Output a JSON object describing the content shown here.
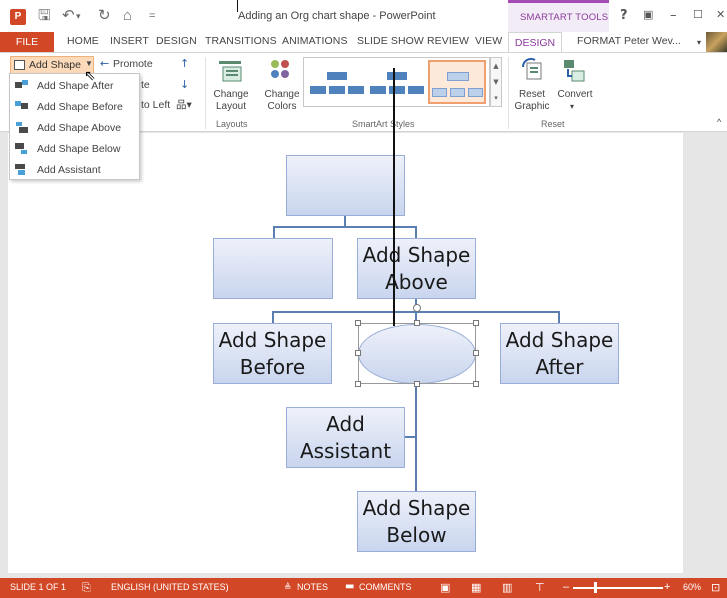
{
  "window": {
    "title": "Adding an Org chart shape - PowerPoint",
    "app_icon": "P",
    "context_group": "SMARTART TOOLS",
    "help": "?",
    "restore": "▣",
    "minimize": "–",
    "maximize": "☐",
    "close": "✕"
  },
  "quick_access": {
    "save": "🖫",
    "undo": "↶",
    "undo_caret": "▾",
    "redo": "↻",
    "slideshow": "⌂",
    "customize": "="
  },
  "tabs": [
    "FILE",
    "HOME",
    "INSERT",
    "DESIGN",
    "TRANSITIONS",
    "ANIMATIONS",
    "SLIDE SHOW",
    "REVIEW",
    "VIEW",
    "DESIGN",
    "FORMAT"
  ],
  "user": {
    "name": "Peter Wev...",
    "caret": "▾"
  },
  "ribbon": {
    "add_shape": "Add Shape",
    "promote": "Promote",
    "demote_partial": "te",
    "right_to_left_partial": "to Left",
    "change_layout": "Change\nLayout",
    "change_colors": "Change\nColors",
    "layouts_group": "Layouts",
    "smartart_styles_group": "SmartArt Styles",
    "reset_graphic": "Reset\nGraphic",
    "convert": "Convert",
    "reset_group": "Reset",
    "collapse": "^"
  },
  "dropdown": [
    {
      "label": "Add Shape After",
      "icon": "add-shape-after-icon"
    },
    {
      "label": "Add Shape Before",
      "icon": "add-shape-before-icon"
    },
    {
      "label": "Add Shape Above",
      "icon": "add-shape-above-icon"
    },
    {
      "label": "Add Shape Below",
      "icon": "add-shape-below-icon"
    },
    {
      "label": "Add Assistant",
      "icon": "add-assistant-icon"
    }
  ],
  "org_chart": {
    "above": "Add Shape\nAbove",
    "before": "Add Shape\nBefore",
    "after": "Add Shape\nAfter",
    "assistant": "Add\nAssistant",
    "below": "Add Shape\nBelow"
  },
  "status": {
    "slide": "SLIDE 1 OF 1",
    "language": "ENGLISH (UNITED STATES)",
    "notes": "NOTES",
    "comments": "COMMENTS",
    "zoom_minus": "–",
    "zoom_plus": "+",
    "zoom": "60%"
  },
  "colors": {
    "accent": "#d24726",
    "smartart": "#a54cb4",
    "node_border": "#98aed6",
    "connector": "#5b7fb3"
  }
}
